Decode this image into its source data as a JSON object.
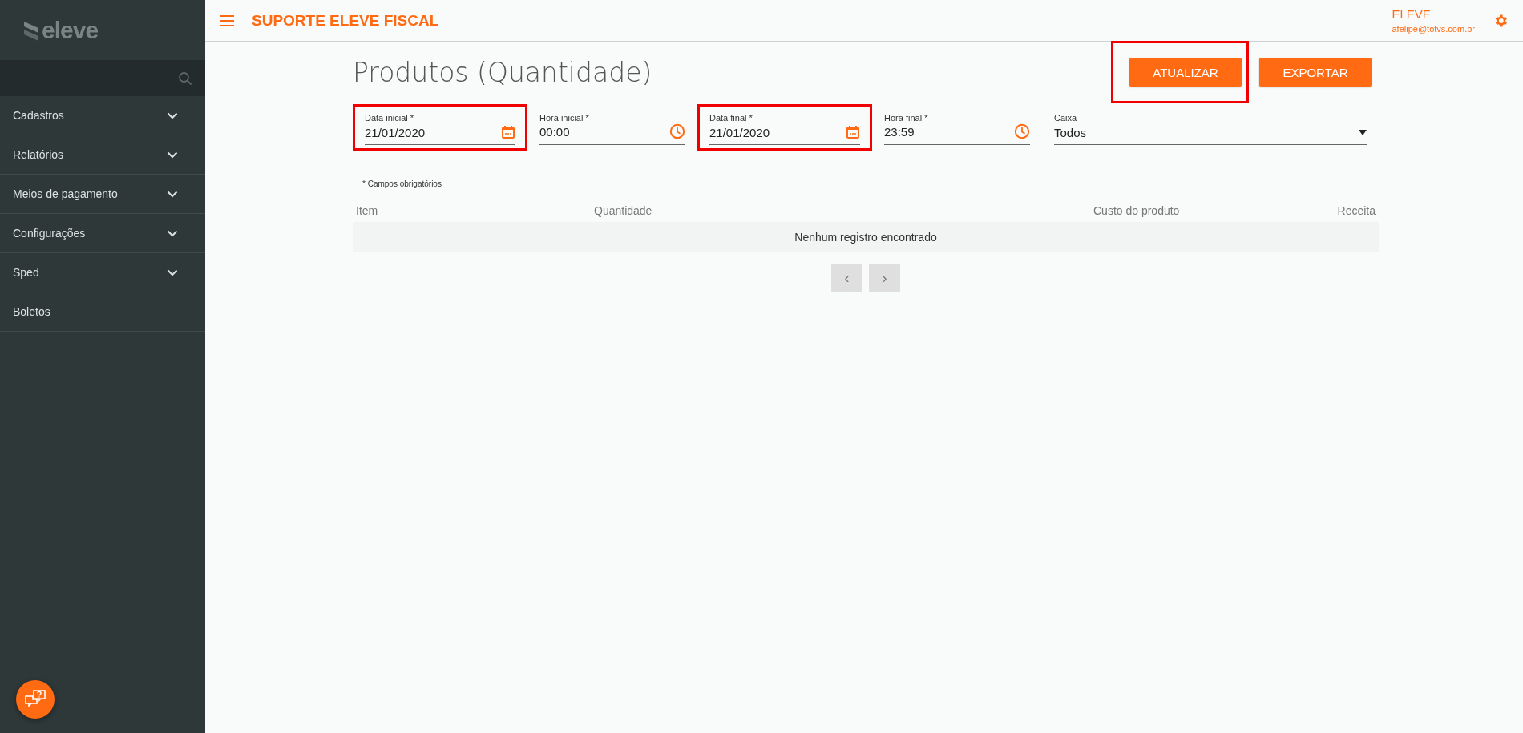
{
  "sidebar": {
    "logo": "eleve",
    "items": [
      {
        "label": "Cadastros",
        "expandable": true
      },
      {
        "label": "Relatórios",
        "expandable": true
      },
      {
        "label": "Meios de pagamento",
        "expandable": true
      },
      {
        "label": "Configurações",
        "expandable": true
      },
      {
        "label": "Sped",
        "expandable": true
      },
      {
        "label": "Boletos",
        "expandable": false
      }
    ]
  },
  "header": {
    "title": "SUPORTE ELEVE FISCAL",
    "user": "ELEVE",
    "email": "afelipe@totvs.com.br"
  },
  "page": {
    "title": "Produtos (Quantidade)",
    "buttons": [
      {
        "label": "ATUALIZAR",
        "highlighted": true
      },
      {
        "label": "EXPORTAR",
        "highlighted": false
      }
    ]
  },
  "filters": [
    {
      "kind": "date",
      "label": "Data inicial *",
      "value": "21/01/2020",
      "highlighted": true
    },
    {
      "kind": "time",
      "label": "Hora inicial *",
      "value": "00:00",
      "highlighted": false
    },
    {
      "kind": "date",
      "label": "Data final *",
      "value": "21/01/2020",
      "highlighted": true
    },
    {
      "kind": "time",
      "label": "Hora final *",
      "value": "23:59",
      "highlighted": false
    },
    {
      "kind": "select",
      "label": "Caixa",
      "value": "Todos",
      "highlighted": false
    }
  ],
  "required_note": "* Campos obrigatórios",
  "table": {
    "columns": [
      "Item",
      "Quantidade",
      "Custo do produto",
      "Receita"
    ],
    "empty_message": "Nenhum registro encontrado"
  },
  "pagination": {
    "prev": "‹",
    "next": "›"
  }
}
